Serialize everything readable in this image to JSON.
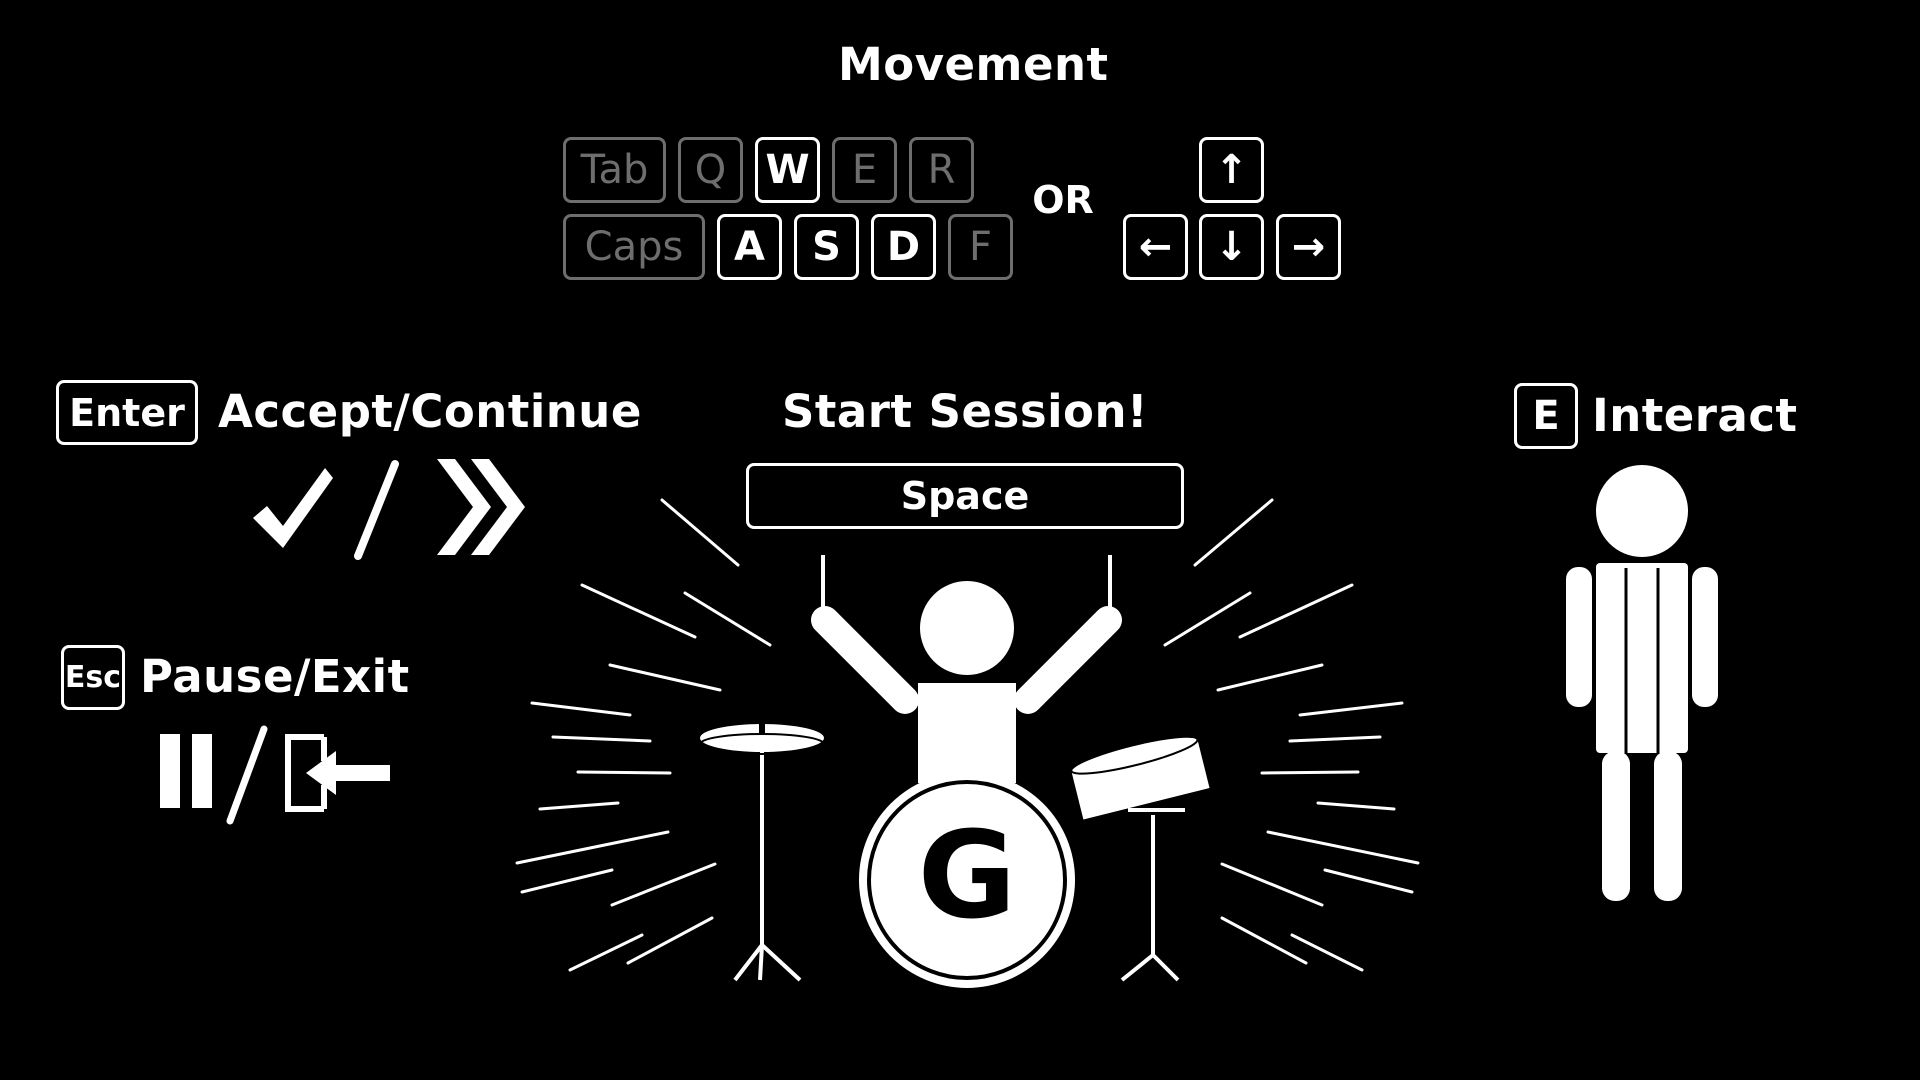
{
  "movement": {
    "title": "Movement",
    "keys_row1": [
      "Tab",
      "Q",
      "W",
      "E",
      "R"
    ],
    "keys_row2": [
      "Caps",
      "A",
      "S",
      "D",
      "F"
    ],
    "or_label": "OR",
    "arrows": {
      "up": "↑",
      "left": "←",
      "down": "↓",
      "right": "→"
    }
  },
  "accept": {
    "key": "Enter",
    "label": "Accept/Continue"
  },
  "pause": {
    "key": "Esc",
    "label": "Pause/Exit"
  },
  "session": {
    "title": "Start Session!",
    "key": "Space",
    "drum_letter": "G"
  },
  "interact": {
    "key": "E",
    "label": "Interact"
  },
  "colors": {
    "background": "#000000",
    "active": "#ffffff",
    "inactive": "#6e6e6e"
  }
}
